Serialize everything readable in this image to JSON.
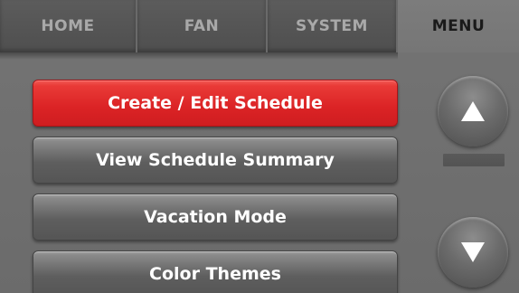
{
  "tabs": {
    "home": "HOME",
    "fan": "FAN",
    "system": "SYSTEM",
    "menu": "MENU",
    "active": "MENU"
  },
  "menu": {
    "items": [
      {
        "label": "Create / Edit Schedule",
        "selected": true
      },
      {
        "label": "View Schedule Summary",
        "selected": false
      },
      {
        "label": "Vacation Mode",
        "selected": false
      },
      {
        "label": "Color Themes",
        "selected": false
      }
    ]
  },
  "controls": {
    "up_icon": "up-arrow-icon",
    "down_icon": "down-arrow-icon"
  },
  "colors": {
    "selected_accent": "#e02a2c",
    "background": "#707070"
  }
}
